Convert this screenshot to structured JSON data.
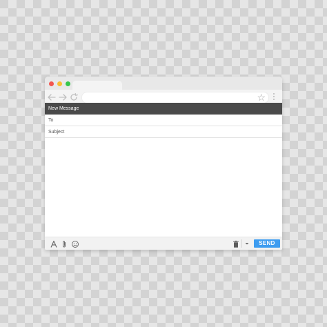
{
  "compose": {
    "header_title": "New Message",
    "to_label": "To",
    "subject_label": "Subject",
    "send_label": "SEND"
  },
  "colors": {
    "send_button": "#3d9cf0",
    "header_bar": "#4a4a4a",
    "close_light": "#f2564f",
    "minimize_light": "#f9be31",
    "zoom_light": "#35c64a"
  },
  "icons": {
    "toolbar": [
      "back-arrow-icon",
      "forward-arrow-icon",
      "reload-icon",
      "star-icon",
      "more-vertical-icon"
    ],
    "bottombar": [
      "text-format-icon",
      "attach-icon",
      "emoji-icon",
      "trash-icon",
      "chevron-down-icon"
    ]
  }
}
